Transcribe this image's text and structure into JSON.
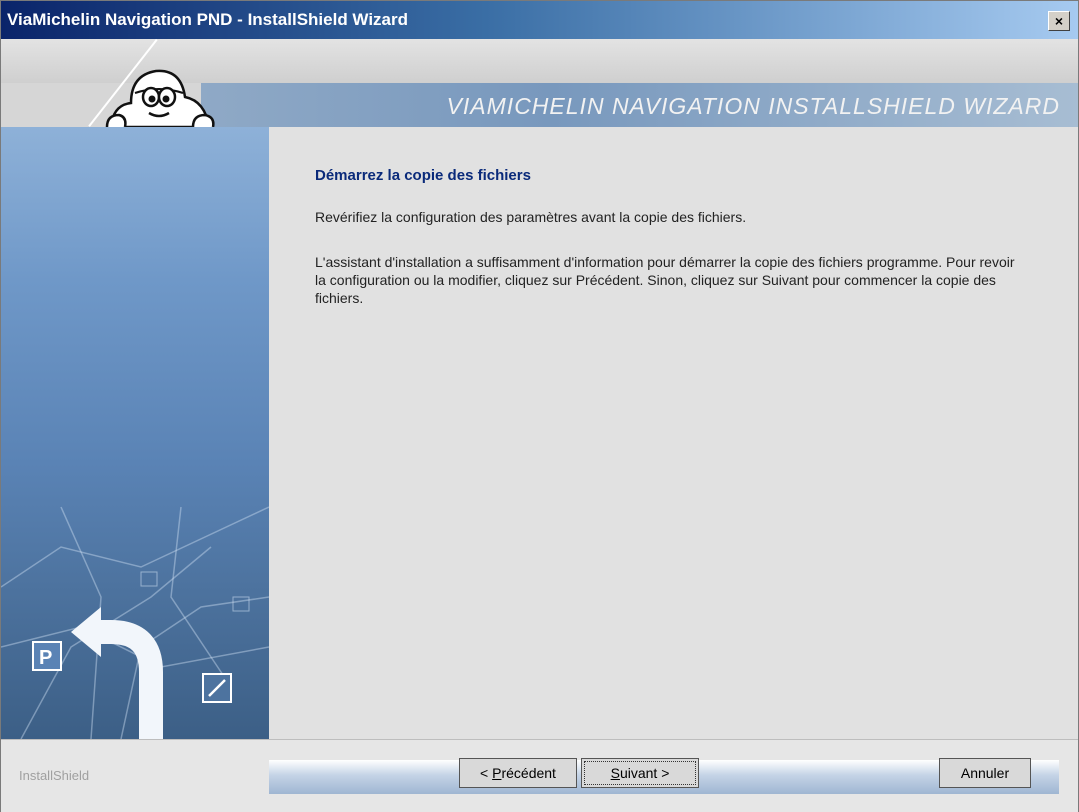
{
  "window": {
    "title": "ViaMichelin Navigation PND - InstallShield Wizard",
    "close_label": "×"
  },
  "banner": {
    "wizard_title": "VIAMICHELIN NAVIGATION INSTALLSHIELD WIZARD"
  },
  "content": {
    "heading": "Démarrez la copie des fichiers",
    "subtitle": "Revérifiez la configuration des paramètres avant la copie des fichiers.",
    "body": "L'assistant d'installation a suffisamment d'information pour démarrer la copie des fichiers programme. Pour revoir la configuration ou la modifier, cliquez sur Précédent. Sinon, cliquez sur Suivant pour commencer la copie des fichiers."
  },
  "footer": {
    "brand": "InstallShield",
    "buttons": {
      "prev_prefix": "< ",
      "prev_accel": "P",
      "prev_rest": "récédent",
      "next_accel": "S",
      "next_rest": "uivant >",
      "cancel": "Annuler"
    }
  },
  "icons": {
    "mascot": "michelin-bibendum-icon",
    "close": "close-icon",
    "parking": "parking-sign-icon",
    "turn_arrow": "turn-arrow-icon"
  },
  "colors": {
    "titlebar_start": "#0a246a",
    "heading": "#0a2a7a",
    "left_panel": "#6f98c8"
  }
}
